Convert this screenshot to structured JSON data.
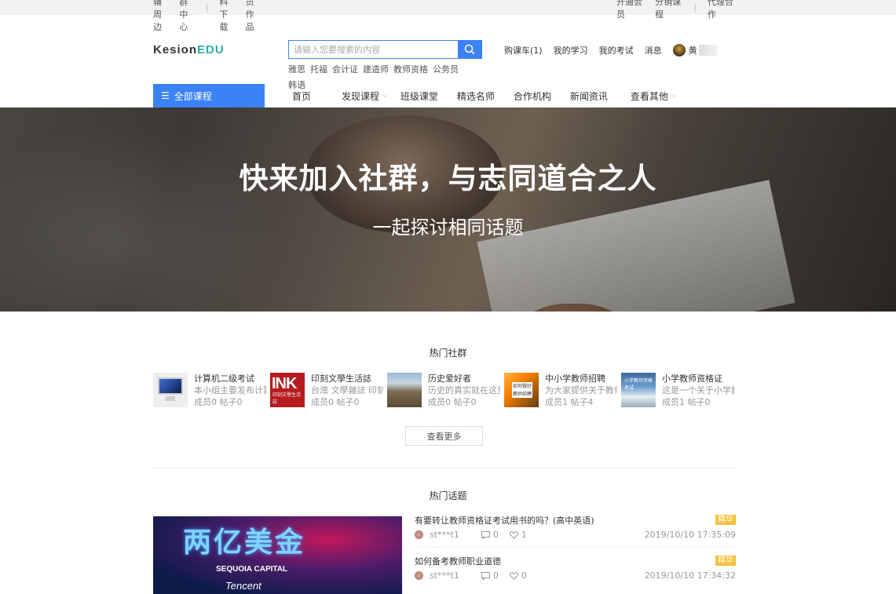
{
  "topbar": {
    "left_links": [
      "教辅周边",
      "社群中心",
      "资料下载",
      "学员作品"
    ],
    "right_links": [
      "开通会员",
      "分销课程",
      "代理合作"
    ]
  },
  "header": {
    "logo_kesion": "Kesion",
    "logo_edu": "EDU",
    "search_placeholder": "请输入您要搜索的内容",
    "hot_keywords": [
      "雅思",
      "托福",
      "会计证",
      "建造师",
      "教师资格",
      "公务员",
      "韩语"
    ],
    "user_nav": {
      "cart": "购课车(1)",
      "my_learning": "我的学习",
      "my_exams": "我的考试",
      "messages": "消息",
      "user_name": "黄"
    }
  },
  "nav": {
    "all_courses": "全部课程",
    "items": [
      {
        "label": "首页"
      },
      {
        "label": "发现课程"
      },
      {
        "label": "班级课堂"
      },
      {
        "label": "精选名师"
      },
      {
        "label": "合作机构"
      },
      {
        "label": "新闻资讯"
      },
      {
        "label": "查看其他"
      }
    ]
  },
  "banner": {
    "title": "快来加入社群，与志同道合之人",
    "subtitle": "一起探讨相同话题"
  },
  "hot_groups": {
    "title": "热门社群",
    "more": "查看更多",
    "items": [
      {
        "name": "计算机二级考试",
        "desc": "本小组主要发布计算机二级考试",
        "stats": "成员0 帖子0",
        "thumb_text": ""
      },
      {
        "name": "印刻文學生活誌",
        "desc": "台灣 文學雜誌 印刻",
        "stats": "成员0 帖子0",
        "thumb_text": "INK"
      },
      {
        "name": "历史爱好者",
        "desc": "历史的真实就在这里",
        "stats": "成员0 帖子0",
        "thumb_text": ""
      },
      {
        "name": "中小学教师招聘",
        "desc": "为大家提供关于教师招聘的信息",
        "stats": "成员1 帖子4",
        "thumb_text": "如何做好教师招聘"
      },
      {
        "name": "小学教师资格证",
        "desc": "这是一个关于小学教师资格证",
        "stats": "成员1 帖子0",
        "thumb_text": "小学教师资格考试"
      }
    ]
  },
  "hot_topics": {
    "title": "热门话题",
    "image_texts": {
      "big": "两亿美金",
      "sequoia": "SEQUOIA CAPITAL",
      "tencent": "Tencent"
    },
    "items": [
      {
        "title": "有要转让教师资格证考试用书的吗？(高中英语)",
        "badge": "精华",
        "user": "st***t1",
        "comments": "0",
        "likes": "1",
        "date": "2019/10/10 17:35:09"
      },
      {
        "title": "如何备考教师职业道德",
        "badge": "精华",
        "user": "st***t1",
        "comments": "0",
        "likes": "0",
        "date": "2019/10/10 17:34:32"
      }
    ]
  }
}
